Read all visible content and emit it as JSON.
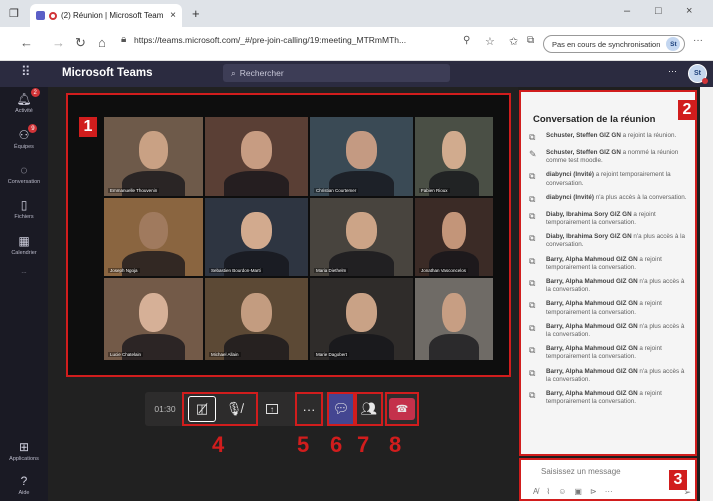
{
  "browser": {
    "tab_title": "(2) Réunion | Microsoft Team",
    "tab_close": "×",
    "new_tab": "+",
    "url": "https://teams.microsoft.com/_#/pre-join-calling/19:meeting_MTRmMTh...",
    "sync_label": "Pas en cours de synchronisation",
    "profile_initials": "St",
    "window_controls": [
      "–",
      "□",
      "×"
    ]
  },
  "teams": {
    "brand": "Microsoft Teams",
    "search_placeholder": "Rechercher",
    "avatar_initials": "St",
    "more": "···"
  },
  "rail": [
    {
      "label": "Activité",
      "icon": "bell-icon",
      "badge": "2"
    },
    {
      "label": "Équipes",
      "icon": "teams-icon",
      "badge": "9"
    },
    {
      "label": "Conversation",
      "icon": "chat-icon",
      "badge": ""
    },
    {
      "label": "Fichiers",
      "icon": "file-icon",
      "badge": ""
    },
    {
      "label": "Calendrier",
      "icon": "calendar-icon",
      "badge": ""
    },
    {
      "label": "···",
      "icon": "more-icon",
      "badge": ""
    },
    {
      "label": "Applications",
      "icon": "apps-icon",
      "badge": ""
    },
    {
      "label": "Aide",
      "icon": "help-icon",
      "badge": ""
    }
  ],
  "video_tiles": [
    {
      "name": "Emmanuelle Thouvenin",
      "bg": "#6e5a4a",
      "face": "#c9a184"
    },
    {
      "name": "",
      "bg": "#5a3f35",
      "face": "#c79c82"
    },
    {
      "name": "Christian Courtemer",
      "bg": "#3a4a55",
      "face": "#c49a82"
    },
    {
      "name": "Fabien Rioux",
      "bg": "#4a4f45",
      "face": "#d1ab8e"
    },
    {
      "name": "Joseph Ngoja",
      "bg": "#8a6540",
      "face": "#a07a5e"
    },
    {
      "name": "Sebastien Bourdon-Marti",
      "bg": "#2e3541",
      "face": "#d2aa8e"
    },
    {
      "name": "Maria Diethelm",
      "bg": "#48443e",
      "face": "#cca487"
    },
    {
      "name": "Jonathan Vasconcelos",
      "bg": "#3b2b26",
      "face": "#c39579"
    },
    {
      "name": "Lucie Chatelain",
      "bg": "#735a48",
      "face": "#d6b097"
    },
    {
      "name": "Michael Allain",
      "bg": "#5c4935",
      "face": "#c39c80"
    },
    {
      "name": "Marie Dagobert",
      "bg": "#2f2c2a",
      "face": "#c9a286"
    },
    {
      "name": "",
      "bg": "#6f6b66",
      "face": "#c79e83"
    },
    {
      "name": "",
      "bg": "#56463a",
      "face": "#b48f74"
    },
    {
      "name": "Guillaume Pelletier",
      "bg": "#242628",
      "face": "#cba489"
    },
    {
      "name": "Florian Baumann",
      "bg": "#4a4036",
      "face": "#c19b7f"
    },
    {
      "name": "",
      "bg": "#222",
      "face": "#222"
    }
  ],
  "controls": {
    "timer": "01:30"
  },
  "markers": [
    "1",
    "2",
    "3",
    "4",
    "5",
    "6",
    "7",
    "8"
  ],
  "chat": {
    "title": "Conversation de la réunion",
    "messages": [
      {
        "icon": "join-icon",
        "name": "Schuster, Steffen GIZ GN",
        "text": "a rejoint la réunion."
      },
      {
        "icon": "pencil-icon",
        "name": "Schuster, Steffen GIZ GN",
        "text": "a nommé la réunion comme test moodle."
      },
      {
        "icon": "join-icon",
        "name": "diabynci (Invité)",
        "text": "a rejoint temporairement la conversation."
      },
      {
        "icon": "join-icon",
        "name": "diabynci (Invité)",
        "text": "n'a plus accès à la conversation."
      },
      {
        "icon": "join-icon",
        "name": "Diaby, Ibrahima Sory GIZ GN",
        "text": "a rejoint temporairement la conversation."
      },
      {
        "icon": "join-icon",
        "name": "Diaby, Ibrahima Sory GIZ GN",
        "text": "n'a plus accès à la conversation."
      },
      {
        "icon": "join-icon",
        "name": "Barry, Alpha Mahmoud GIZ GN",
        "text": "a rejoint temporairement la conversation."
      },
      {
        "icon": "join-icon",
        "name": "Barry, Alpha Mahmoud GIZ GN",
        "text": "n'a plus accès à la conversation."
      },
      {
        "icon": "join-icon",
        "name": "Barry, Alpha Mahmoud GIZ GN",
        "text": "a rejoint temporairement la conversation."
      },
      {
        "icon": "join-icon",
        "name": "Barry, Alpha Mahmoud GIZ GN",
        "text": "n'a plus accès à la conversation."
      },
      {
        "icon": "join-icon",
        "name": "Barry, Alpha Mahmoud GIZ GN",
        "text": "a rejoint temporairement la conversation."
      },
      {
        "icon": "join-icon",
        "name": "Barry, Alpha Mahmoud GIZ GN",
        "text": "n'a plus accès à la conversation."
      },
      {
        "icon": "join-icon",
        "name": "Barry, Alpha Mahmoud GIZ GN",
        "text": "a rejoint temporairement la conversation."
      }
    ],
    "compose_placeholder": "Saisissez un message"
  },
  "colors": {
    "accent_red": "#d11d1d",
    "teams_purple": "#444691",
    "hangup": "#c4314b"
  }
}
